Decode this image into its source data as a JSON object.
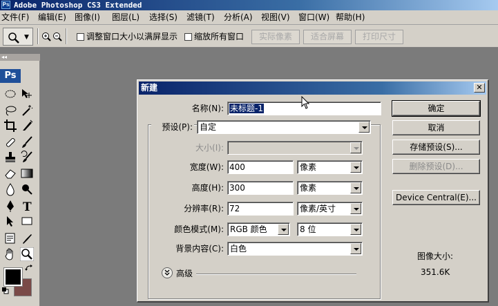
{
  "titlebar": {
    "badge": "Ps",
    "title": "Adobe Photoshop CS3 Extended"
  },
  "menubar": {
    "items": [
      "文件(F)",
      "编辑(E)",
      "图像(I)",
      "图层(L)",
      "选择(S)",
      "滤镜(T)",
      "分析(A)",
      "视图(V)",
      "窗口(W)",
      "帮助(H)"
    ]
  },
  "options": {
    "resize_windows_label": "调整窗口大小以满屏显示",
    "zoom_all_label": "缩放所有窗口",
    "actual_pixels": "实际像素",
    "fit_screen": "适合屏幕",
    "print_size": "打印尺寸"
  },
  "toolbox": {
    "collapse": "◂◂",
    "badge": "Ps",
    "foreground_color": "#000000",
    "background_color": "#7a4a48"
  },
  "dialog": {
    "title": "新建",
    "close": "✕",
    "name_label": "名称(N):",
    "name_value": "未标题-1",
    "preset_label": "预设(P):",
    "preset_value": "自定",
    "size_label": "大小(I):",
    "size_value": "",
    "width_label": "宽度(W):",
    "width_value": "400",
    "width_unit": "像素",
    "height_label": "高度(H):",
    "height_value": "300",
    "height_unit": "像素",
    "resolution_label": "分辨率(R):",
    "resolution_value": "72",
    "resolution_unit": "像素/英寸",
    "color_mode_label": "颜色模式(M):",
    "color_mode_value": "RGB 颜色",
    "bit_depth_value": "8 位",
    "bg_contents_label": "背景内容(C):",
    "bg_contents_value": "白色",
    "advanced_label": "高级",
    "advanced_icon": "double-chevron-down",
    "ok": "确定",
    "cancel": "取消",
    "save_preset": "存储预设(S)...",
    "delete_preset": "删除预设(D)...",
    "device_central": "Device Central(E)...",
    "image_size_label": "图像大小:",
    "image_size_value": "351.6K"
  }
}
